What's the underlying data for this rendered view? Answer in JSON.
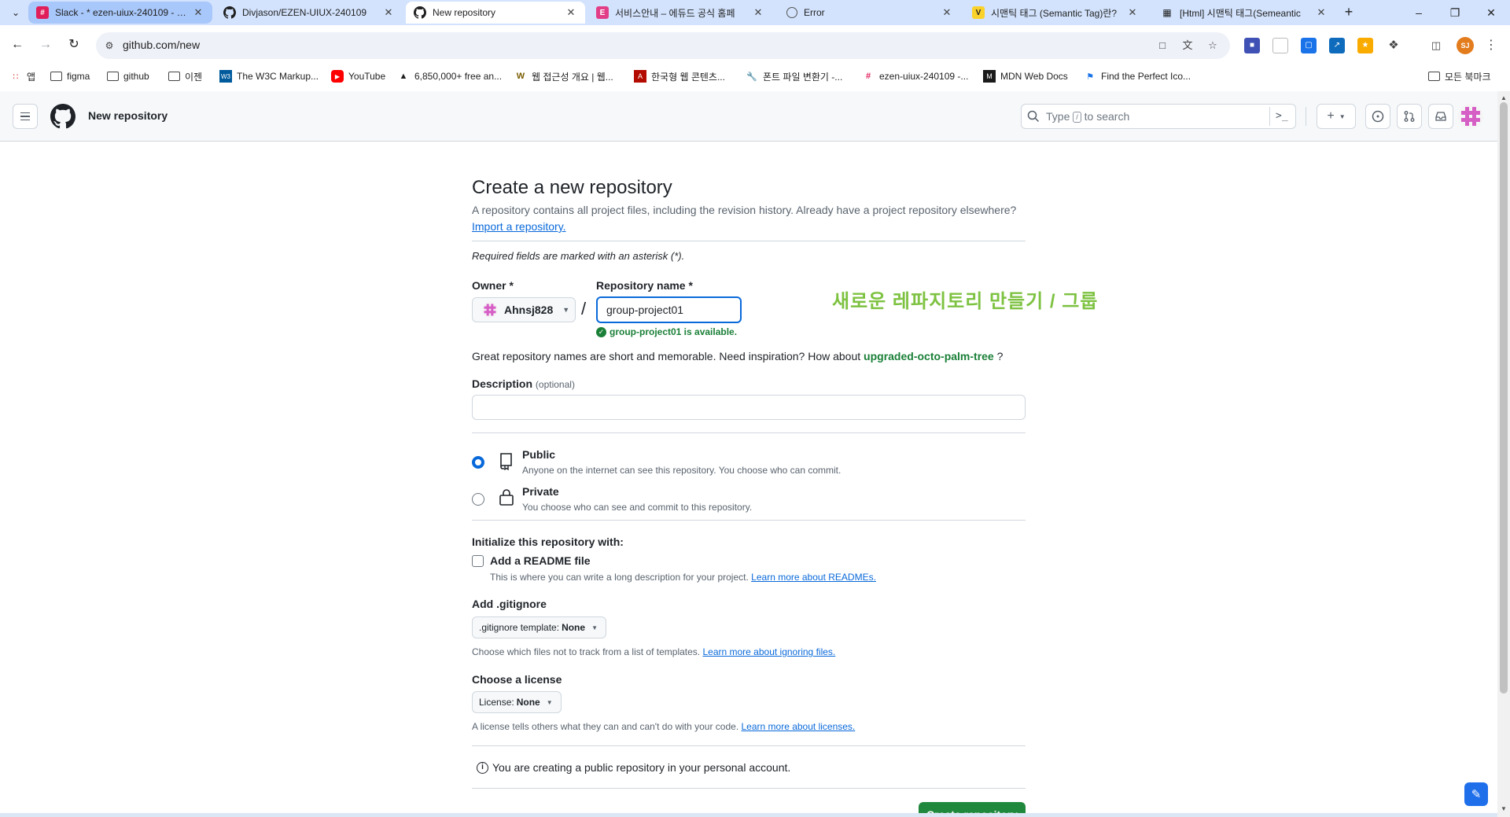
{
  "browser": {
    "tabs": [
      {
        "title": "Slack - * ezen-uiux-240109 - …",
        "close": "✕"
      },
      {
        "title": "Divjason/EZEN-UIUX-240109",
        "close": "✕"
      },
      {
        "title": "New repository",
        "close": "✕"
      },
      {
        "title": "서비스안내 – 에듀드 공식 홈페",
        "close": "✕"
      },
      {
        "title": "Error",
        "close": "✕"
      },
      {
        "title": "시맨틱 태그 (Semantic Tag)란?",
        "close": "✕"
      },
      {
        "title": "[Html] 시맨틱 태그(Semeantic",
        "close": "✕"
      }
    ],
    "new_tab": "+",
    "url": "github.com/new",
    "bookmarks": [
      {
        "label": "앱",
        "icon": "apps-grid-icon"
      },
      {
        "label": "figma",
        "icon": "folder-icon"
      },
      {
        "label": "github",
        "icon": "folder-icon"
      },
      {
        "label": "이젠",
        "icon": "folder-icon"
      },
      {
        "label": "The W3C Markup...",
        "icon": "w3c-icon"
      },
      {
        "label": "YouTube",
        "icon": "youtube-icon"
      },
      {
        "label": "6,850,000+ free an...",
        "icon": "flaticon-icon"
      },
      {
        "label": "웹 접근성 개요 | 웹...",
        "icon": "wa-icon"
      },
      {
        "label": "한국형 웹 콘텐츠...",
        "icon": "pdf-icon"
      },
      {
        "label": "폰트 파일 변환기 -...",
        "icon": "wrench-icon"
      },
      {
        "label": "ezen-uiux-240109 -...",
        "icon": "slack-icon"
      },
      {
        "label": "MDN Web Docs",
        "icon": "mdn-icon"
      },
      {
        "label": "Find the Perfect Ico...",
        "icon": "flag-icon"
      }
    ],
    "all_bookmarks": "모든 북마크",
    "profile_initials": "SJ"
  },
  "header": {
    "context": "New repository",
    "search_placeholder_before": "Type",
    "search_slash": "/",
    "search_placeholder_after": "to search",
    "command_glyph": ">_",
    "plus_glyph": "+"
  },
  "form": {
    "title": "Create a new repository",
    "subtitle": "A repository contains all project files, including the revision history. Already have a project repository elsewhere?",
    "import_link": "Import a repository.",
    "required_note": "Required fields are marked with an asterisk (*).",
    "owner_label": "Owner *",
    "owner_value": "Ahnsj828",
    "slash": "/",
    "repo_label": "Repository name *",
    "repo_value": "group-project01",
    "available_msg": "group-project01 is available.",
    "annotation": "새로운 레파지토리 만들기 / 그룹",
    "inspiration_text": "Great repository names are short and memorable. Need inspiration? How about",
    "inspiration_suggestion": "upgraded-octo-palm-tree",
    "inspiration_end": "?",
    "description_label": "Description",
    "description_optional": "(optional)",
    "visibility": {
      "public_title": "Public",
      "public_desc": "Anyone on the internet can see this repository. You choose who can commit.",
      "private_title": "Private",
      "private_desc": "You choose who can see and commit to this repository.",
      "selected": "public"
    },
    "init_label": "Initialize this repository with:",
    "readme_label": "Add a README file",
    "readme_desc": "This is where you can write a long description for your project.",
    "readme_link": "Learn more about READMEs.",
    "gitignore_label": "Add .gitignore",
    "gitignore_btn_prefix": ".gitignore template:",
    "gitignore_btn_value": "None",
    "gitignore_desc": "Choose which files not to track from a list of templates.",
    "gitignore_link": "Learn more about ignoring files.",
    "license_label": "Choose a license",
    "license_btn_prefix": "License:",
    "license_btn_value": "None",
    "license_desc": "A license tells others what they can and can't do with your code.",
    "license_link": "Learn more about licenses.",
    "info_msg": "You are creating a public repository in your personal account.",
    "create_button": "Create repository"
  },
  "colors": {
    "accent": "#0969da",
    "success": "#1a7f37",
    "create_button": "#1f883d",
    "annotation": "#7dc241"
  }
}
